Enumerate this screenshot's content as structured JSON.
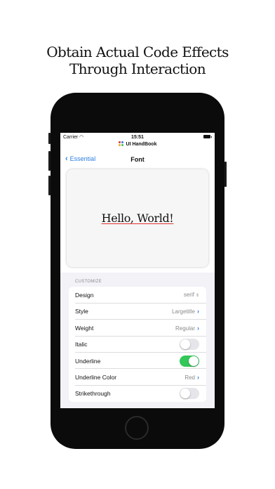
{
  "headline": [
    "Obtain Actual Code Effects",
    "Through Interaction"
  ],
  "status_bar": {
    "carrier": "Carrier",
    "time": "15:51"
  },
  "app_title": "UI HandBook",
  "nav": {
    "back_label": "Essential",
    "title": "Font"
  },
  "preview": {
    "text": "Hello, World!"
  },
  "section": {
    "header": "CUSTOMIZE"
  },
  "rows": [
    {
      "label": "Design",
      "value": "serif"
    },
    {
      "label": "Style",
      "value": "Largetitle"
    },
    {
      "label": "Weight",
      "value": "Regular"
    },
    {
      "label": "Italic",
      "toggle": false
    },
    {
      "label": "Underline",
      "toggle": true
    },
    {
      "label": "Underline Color",
      "value": "Red"
    },
    {
      "label": "Strikethrough",
      "toggle": false
    }
  ],
  "colors": {
    "accent": "#2f7de1",
    "toggle_on": "#34c759",
    "underline": "#e03131"
  }
}
